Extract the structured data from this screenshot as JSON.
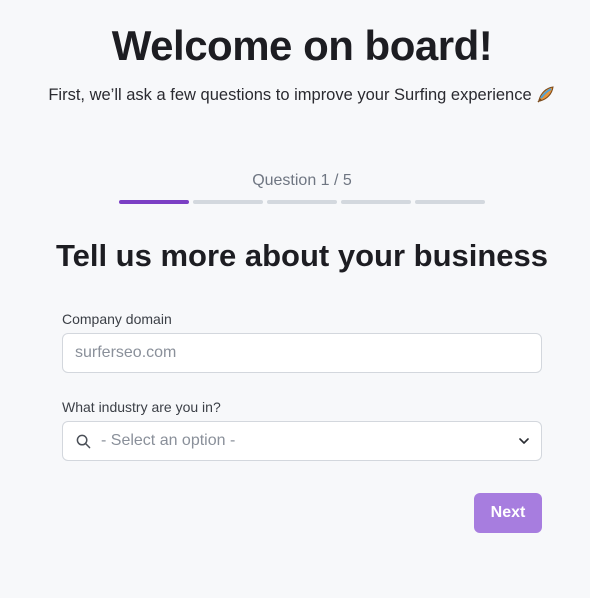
{
  "header": {
    "title": "Welcome on board!",
    "subtitle": "First, we’ll ask a few questions to improve your Surfing experience",
    "subtitle_icon": "surfboard-icon"
  },
  "progress": {
    "label": "Question 1 / 5",
    "current": 1,
    "total": 5,
    "active_color": "#7b3fc4",
    "inactive_color": "#d3d8de"
  },
  "form": {
    "heading": "Tell us more about your business",
    "company_domain": {
      "label": "Company domain",
      "placeholder": "surferseo.com",
      "value": ""
    },
    "industry": {
      "label": "What industry are you in?",
      "placeholder": "- Select an option -",
      "icon": "search-icon",
      "dropdown_icon": "chevron-down-icon"
    }
  },
  "actions": {
    "next_label": "Next",
    "next_color": "#a77ddf"
  }
}
